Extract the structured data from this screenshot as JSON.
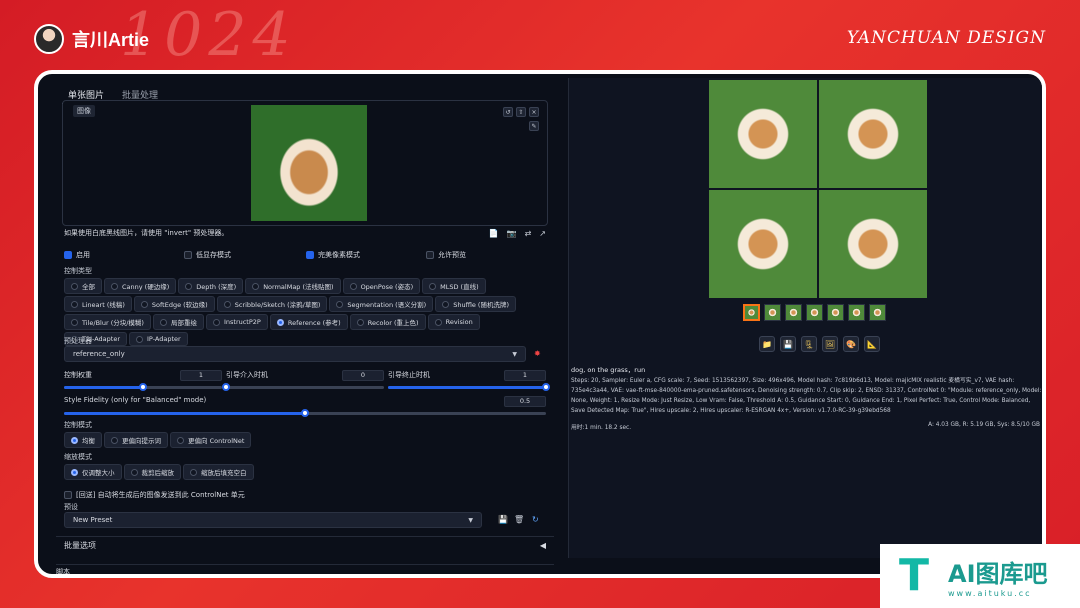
{
  "header": {
    "brand_name": "言川Artie",
    "design_tag": "YANCHUAN DESIGN",
    "bg_deco": "1024"
  },
  "tabs": [
    {
      "label": "单张图片"
    },
    {
      "label": "批量处理"
    }
  ],
  "image_box": {
    "label": "图像",
    "tools": [
      "↺",
      "⇧",
      "×"
    ],
    "edit": "✎"
  },
  "hint": "如果使用白底黑线图片，请使用 \"invert\" 预处理器。",
  "hint_icons": [
    "📄",
    "📷",
    "⇄",
    "↗"
  ],
  "options": {
    "enable": "启用",
    "low_vram": "低显存模式",
    "pixel_perfect": "完美像素模式",
    "allow_preview": "允许预览"
  },
  "control_type": {
    "label": "控制类型",
    "items": [
      "全部",
      "Canny (硬边缘)",
      "Depth (深度)",
      "NormalMap (法线贴图)",
      "OpenPose (姿态)",
      "MLSD (直线)",
      "Lineart (线稿)",
      "SoftEdge (软边缘)",
      "Scribble/Sketch (涂鸦/草图)",
      "Segmentation (语义分割)",
      "Shuffle (随机洗牌)",
      "Tile/Blur (分块/模糊)",
      "局部重绘",
      "InstructP2P",
      "Reference (参考)",
      "Recolor (重上色)",
      "Revision",
      "T2I-Adapter",
      "IP-Adapter"
    ],
    "selected_index": 14
  },
  "preprocessor": {
    "label": "预处理器",
    "value": "reference_only",
    "caret": "▼",
    "run_icon": "✸"
  },
  "sliders": {
    "weight": {
      "label": "控制权重",
      "value": "1"
    },
    "start": {
      "label": "引导介入时机",
      "value": "0"
    },
    "end": {
      "label": "引导终止时机",
      "value": "1"
    },
    "fidelity": {
      "label": "Style Fidelity (only for \"Balanced\" mode)",
      "value": "0.5"
    },
    "weight_level": 0.5,
    "start_level": 0,
    "end_level": 1,
    "fidelity_level": 0.5
  },
  "control_mode": {
    "label": "控制模式",
    "items": [
      "均衡",
      "更偏向提示词",
      "更偏向 ControlNet"
    ],
    "selected_index": 0
  },
  "resize_mode": {
    "label": "缩放模式",
    "items": [
      "仅调整大小",
      "裁剪后缩放",
      "缩放后填充空白"
    ],
    "selected_index": 0
  },
  "loopback": "[回送] 自动将生成后的图像发送到此 ControlNet 单元",
  "preset": {
    "label": "预设",
    "value": "New Preset",
    "caret": "▼",
    "icons": [
      "💾",
      "🗑",
      "↻"
    ]
  },
  "batch_accordion": {
    "label": "批量选项",
    "arrow": "◀"
  },
  "script_label": "脚本",
  "output": {
    "actions": [
      "📁",
      "💾",
      "🗜",
      "🖼",
      "🎨",
      "📐"
    ],
    "prompt": "dog, on the grass，run",
    "params": "Steps: 20, Sampler: Euler a, CFG scale: 7, Seed: 1513562397, Size: 496x496, Model hash: 7c819b6d13, Model: majicMIX realistic 麦橘写实_v7, VAE hash: 735e4c3a44, VAE: vae-ft-mse-840000-ema-pruned.safetensors, Denoising strength: 0.7, Clip skip: 2, ENSD: 31337, ControlNet 0: \"Module: reference_only, Model: None, Weight: 1, Resize Mode: Just Resize, Low Vram: False, Threshold A: 0.5, Guidance Start: 0, Guidance End: 1, Pixel Perfect: True, Control Mode: Balanced, Save Detected Map: True\", Hires upscale: 2, Hires upscaler: R-ESRGAN 4x+, Version: v1.7.0-RC-39-g39ebd568",
    "time": "用时:1 min. 18.2 sec.",
    "memory": "A: 4.03 GB, R: 5.19 GB, Sys: 8.5/10 GB"
  },
  "watermark": {
    "logo": "T",
    "title": "AI图库吧",
    "url": "www.aituku.cc"
  }
}
